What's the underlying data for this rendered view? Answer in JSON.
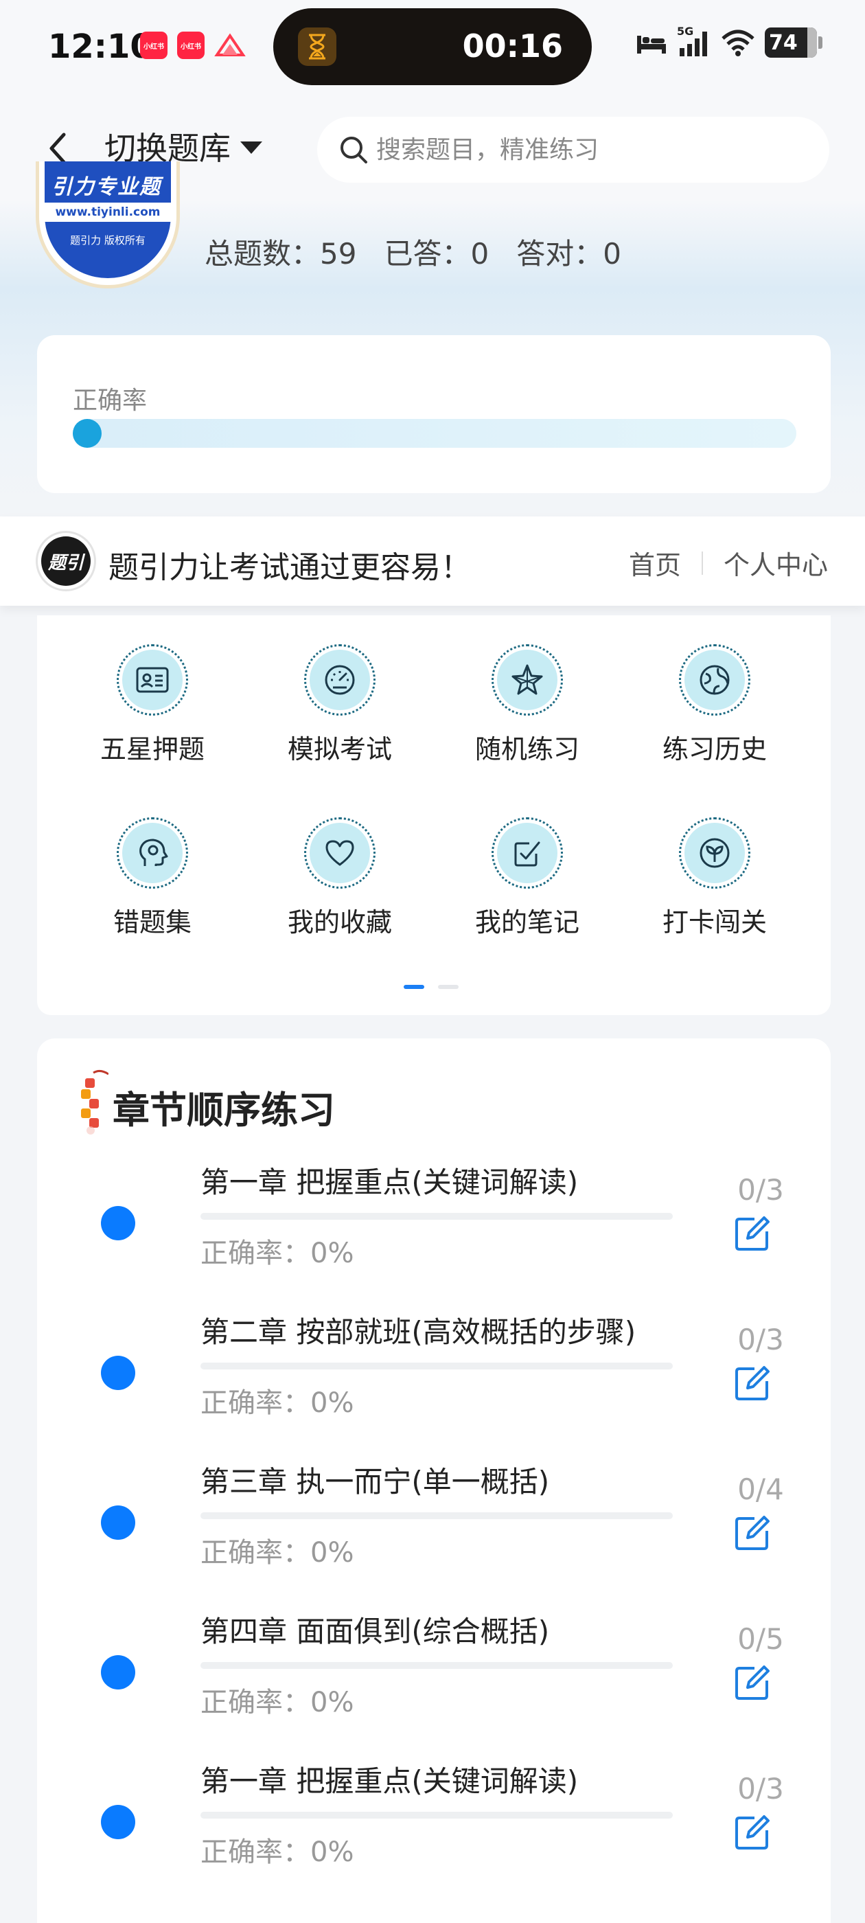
{
  "status_bar": {
    "time": "12:10",
    "app_icons": [
      {
        "name": "xiaohongshu-icon",
        "label": "小红书"
      },
      {
        "name": "xiaohongshu-icon",
        "label": "小红书"
      },
      {
        "name": "mountain-app-icon",
        "label": ""
      }
    ],
    "timer": "00:16",
    "network": "5G",
    "battery": "74"
  },
  "header": {
    "back_icon": "chevron-left-icon",
    "switch_label": "切换题库",
    "search_placeholder": "搜索题目，精准练习"
  },
  "hero": {
    "logo_url": "www.tiyinli.com",
    "logo_copyright": "题引力 版权所有",
    "stats": {
      "total": "总题数：59",
      "answered": "已答：0",
      "correct": "答对：0"
    }
  },
  "accuracy": {
    "label": "正确率",
    "value_fraction": 0.0
  },
  "ad_bar": {
    "logo_text": "题引力",
    "slogan": "题引力让考试通过更容易！",
    "links": [
      "首页",
      "个人中心"
    ]
  },
  "features": [
    {
      "label": "五星押题",
      "icon": "id-card-icon"
    },
    {
      "label": "模拟考试",
      "icon": "speedometer-icon"
    },
    {
      "label": "随机练习",
      "icon": "star-icon"
    },
    {
      "label": "练习历史",
      "icon": "globe-icon"
    },
    {
      "label": "错题集",
      "icon": "head-icon"
    },
    {
      "label": "我的收藏",
      "icon": "heart-icon"
    },
    {
      "label": "我的笔记",
      "icon": "checkbox-icon"
    },
    {
      "label": "打卡闯关",
      "icon": "sprout-icon"
    }
  ],
  "pager": {
    "pages": 2,
    "active": 0
  },
  "chapters": {
    "title": "章节顺序练习",
    "items": [
      {
        "title": "第一章 把握重点(关键词解读)",
        "accuracy": "正确率：0%",
        "count": "0/3"
      },
      {
        "title": "第二章 按部就班(高效概括的步骤)",
        "accuracy": "正确率：0%",
        "count": "0/3"
      },
      {
        "title": "第三章 执一而宁(单一概括)",
        "accuracy": "正确率：0%",
        "count": "0/4"
      },
      {
        "title": "第四章 面面俱到(综合概括)",
        "accuracy": "正确率：0%",
        "count": "0/5"
      },
      {
        "title": "第一章 把握重点(关键词解读)",
        "accuracy": "正确率：0%",
        "count": "0/3"
      }
    ]
  }
}
